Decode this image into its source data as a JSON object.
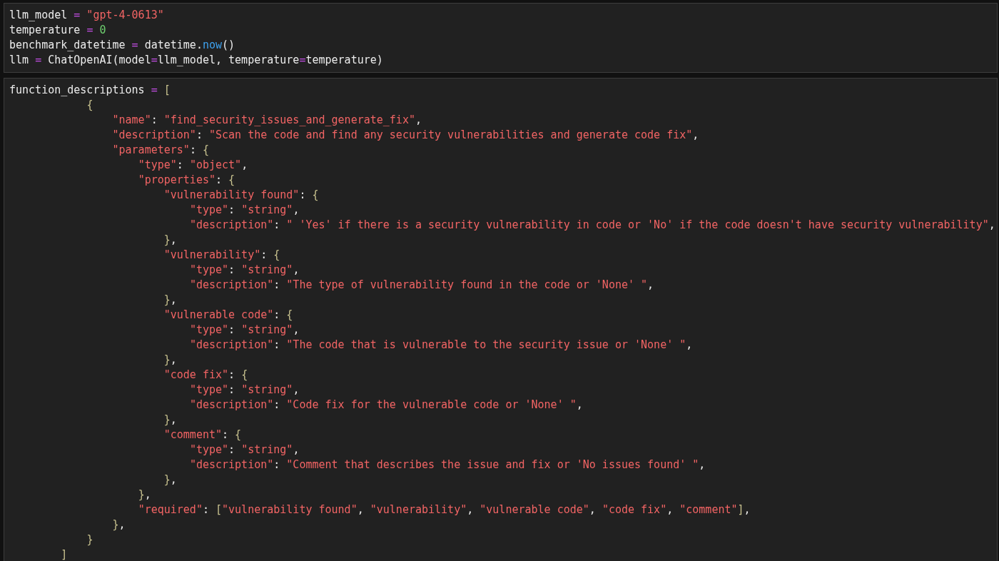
{
  "cells": [
    {
      "lines": [
        [
          {
            "kind": "plain",
            "text": "llm_model "
          },
          {
            "kind": "operator",
            "text": "="
          },
          {
            "kind": "string",
            "text": " \"gpt-4-0613\""
          }
        ],
        [
          {
            "kind": "plain",
            "text": "temperature "
          },
          {
            "kind": "operator",
            "text": "="
          },
          {
            "kind": "number",
            "text": " 0"
          }
        ],
        [
          {
            "kind": "plain",
            "text": "benchmark_datetime "
          },
          {
            "kind": "operator",
            "text": "="
          },
          {
            "kind": "plain",
            "text": " datetime."
          },
          {
            "kind": "function",
            "text": "now"
          },
          {
            "kind": "plain",
            "text": "()"
          }
        ],
        [
          {
            "kind": "plain",
            "text": "llm "
          },
          {
            "kind": "operator",
            "text": "="
          },
          {
            "kind": "plain",
            "text": " ChatOpenAI(model"
          },
          {
            "kind": "operator",
            "text": "="
          },
          {
            "kind": "plain",
            "text": "llm_model, temperature"
          },
          {
            "kind": "operator",
            "text": "="
          },
          {
            "kind": "plain",
            "text": "temperature)"
          }
        ]
      ]
    },
    {
      "lines": [
        [
          {
            "kind": "plain",
            "text": "function_descriptions "
          },
          {
            "kind": "operator",
            "text": "="
          },
          {
            "kind": "bracket",
            "text": " ["
          }
        ],
        [
          {
            "kind": "bracket",
            "text": "            {"
          }
        ],
        [
          {
            "kind": "string",
            "text": "                \"name\""
          },
          {
            "kind": "plain",
            "text": ": "
          },
          {
            "kind": "string",
            "text": "\"find_security_issues_and_generate_fix\""
          },
          {
            "kind": "plain",
            "text": ","
          }
        ],
        [
          {
            "kind": "string",
            "text": "                \"description\""
          },
          {
            "kind": "plain",
            "text": ": "
          },
          {
            "kind": "string",
            "text": "\"Scan the code and find any security vulnerabilities and generate code fix\""
          },
          {
            "kind": "plain",
            "text": ","
          }
        ],
        [
          {
            "kind": "string",
            "text": "                \"parameters\""
          },
          {
            "kind": "plain",
            "text": ": "
          },
          {
            "kind": "bracket",
            "text": "{"
          }
        ],
        [
          {
            "kind": "string",
            "text": "                    \"type\""
          },
          {
            "kind": "plain",
            "text": ": "
          },
          {
            "kind": "string",
            "text": "\"object\""
          },
          {
            "kind": "plain",
            "text": ","
          }
        ],
        [
          {
            "kind": "string",
            "text": "                    \"properties\""
          },
          {
            "kind": "plain",
            "text": ": "
          },
          {
            "kind": "bracket",
            "text": "{"
          }
        ],
        [
          {
            "kind": "string",
            "text": "                        \"vulnerability found\""
          },
          {
            "kind": "plain",
            "text": ": "
          },
          {
            "kind": "bracket",
            "text": "{"
          }
        ],
        [
          {
            "kind": "string",
            "text": "                            \"type\""
          },
          {
            "kind": "plain",
            "text": ": "
          },
          {
            "kind": "string",
            "text": "\"string\""
          },
          {
            "kind": "plain",
            "text": ","
          }
        ],
        [
          {
            "kind": "string",
            "text": "                            \"description\""
          },
          {
            "kind": "plain",
            "text": ": "
          },
          {
            "kind": "string",
            "text": "\" 'Yes' if there is a security vulnerability in code or 'No' if the code doesn't have security vulnerability\""
          },
          {
            "kind": "plain",
            "text": ","
          }
        ],
        [
          {
            "kind": "bracket",
            "text": "                        }"
          },
          {
            "kind": "plain",
            "text": ","
          }
        ],
        [
          {
            "kind": "string",
            "text": "                        \"vulnerability\""
          },
          {
            "kind": "plain",
            "text": ": "
          },
          {
            "kind": "bracket",
            "text": "{"
          }
        ],
        [
          {
            "kind": "string",
            "text": "                            \"type\""
          },
          {
            "kind": "plain",
            "text": ": "
          },
          {
            "kind": "string",
            "text": "\"string\""
          },
          {
            "kind": "plain",
            "text": ","
          }
        ],
        [
          {
            "kind": "string",
            "text": "                            \"description\""
          },
          {
            "kind": "plain",
            "text": ": "
          },
          {
            "kind": "string",
            "text": "\"The type of vulnerability found in the code or 'None' \""
          },
          {
            "kind": "plain",
            "text": ","
          }
        ],
        [
          {
            "kind": "bracket",
            "text": "                        }"
          },
          {
            "kind": "plain",
            "text": ","
          }
        ],
        [
          {
            "kind": "string",
            "text": "                        \"vulnerable code\""
          },
          {
            "kind": "plain",
            "text": ": "
          },
          {
            "kind": "bracket",
            "text": "{"
          }
        ],
        [
          {
            "kind": "string",
            "text": "                            \"type\""
          },
          {
            "kind": "plain",
            "text": ": "
          },
          {
            "kind": "string",
            "text": "\"string\""
          },
          {
            "kind": "plain",
            "text": ","
          }
        ],
        [
          {
            "kind": "string",
            "text": "                            \"description\""
          },
          {
            "kind": "plain",
            "text": ": "
          },
          {
            "kind": "string",
            "text": "\"The code that is vulnerable to the security issue or 'None' \""
          },
          {
            "kind": "plain",
            "text": ","
          }
        ],
        [
          {
            "kind": "bracket",
            "text": "                        }"
          },
          {
            "kind": "plain",
            "text": ","
          }
        ],
        [
          {
            "kind": "string",
            "text": "                        \"code fix\""
          },
          {
            "kind": "plain",
            "text": ": "
          },
          {
            "kind": "bracket",
            "text": "{"
          }
        ],
        [
          {
            "kind": "string",
            "text": "                            \"type\""
          },
          {
            "kind": "plain",
            "text": ": "
          },
          {
            "kind": "string",
            "text": "\"string\""
          },
          {
            "kind": "plain",
            "text": ","
          }
        ],
        [
          {
            "kind": "string",
            "text": "                            \"description\""
          },
          {
            "kind": "plain",
            "text": ": "
          },
          {
            "kind": "string",
            "text": "\"Code fix for the vulnerable code or 'None' \""
          },
          {
            "kind": "plain",
            "text": ","
          }
        ],
        [
          {
            "kind": "bracket",
            "text": "                        }"
          },
          {
            "kind": "plain",
            "text": ","
          }
        ],
        [
          {
            "kind": "string",
            "text": "                        \"comment\""
          },
          {
            "kind": "plain",
            "text": ": "
          },
          {
            "kind": "bracket",
            "text": "{"
          }
        ],
        [
          {
            "kind": "string",
            "text": "                            \"type\""
          },
          {
            "kind": "plain",
            "text": ": "
          },
          {
            "kind": "string",
            "text": "\"string\""
          },
          {
            "kind": "plain",
            "text": ","
          }
        ],
        [
          {
            "kind": "string",
            "text": "                            \"description\""
          },
          {
            "kind": "plain",
            "text": ": "
          },
          {
            "kind": "string",
            "text": "\"Comment that describes the issue and fix or 'No issues found' \""
          },
          {
            "kind": "plain",
            "text": ","
          }
        ],
        [
          {
            "kind": "bracket",
            "text": "                        }"
          },
          {
            "kind": "plain",
            "text": ","
          }
        ],
        [
          {
            "kind": "bracket",
            "text": "                    }"
          },
          {
            "kind": "plain",
            "text": ","
          }
        ],
        [
          {
            "kind": "string",
            "text": "                    \"required\""
          },
          {
            "kind": "plain",
            "text": ": "
          },
          {
            "kind": "bracket",
            "text": "["
          },
          {
            "kind": "string",
            "text": "\"vulnerability found\""
          },
          {
            "kind": "plain",
            "text": ", "
          },
          {
            "kind": "string",
            "text": "\"vulnerability\""
          },
          {
            "kind": "plain",
            "text": ", "
          },
          {
            "kind": "string",
            "text": "\"vulnerable code\""
          },
          {
            "kind": "plain",
            "text": ", "
          },
          {
            "kind": "string",
            "text": "\"code fix\""
          },
          {
            "kind": "plain",
            "text": ", "
          },
          {
            "kind": "string",
            "text": "\"comment\""
          },
          {
            "kind": "bracket",
            "text": "]"
          },
          {
            "kind": "plain",
            "text": ","
          }
        ],
        [
          {
            "kind": "bracket",
            "text": "                }"
          },
          {
            "kind": "plain",
            "text": ","
          }
        ],
        [
          {
            "kind": "bracket",
            "text": "            }"
          }
        ],
        [
          {
            "kind": "bracket",
            "text": "        ]"
          }
        ]
      ]
    }
  ]
}
